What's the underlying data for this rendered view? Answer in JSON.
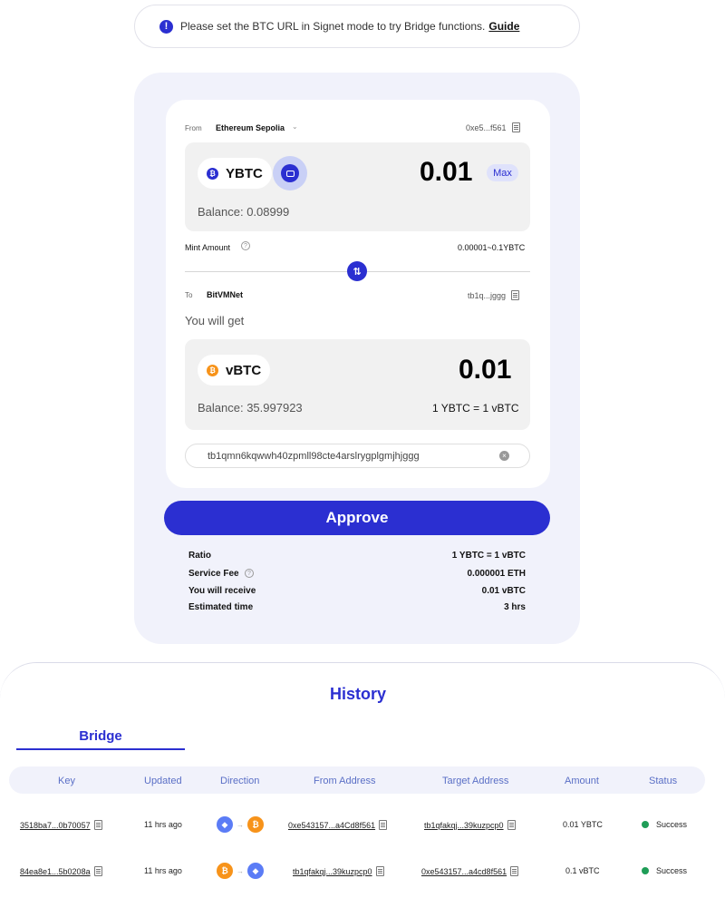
{
  "banner": {
    "message": "Please set the BTC URL in Signet mode to try Bridge functions.",
    "link": "Guide"
  },
  "bridge_form": {
    "from_label": "From",
    "from_network": "Ethereum Sepolia",
    "from_address": "0xe5...f561",
    "from_token": "YBTC",
    "amount": "0.01",
    "max_label": "Max",
    "from_balance": "Balance: 0.08999",
    "mint_amount_label": "Mint Amount",
    "mint_range": "0.00001~0.1YBTC",
    "to_label": "To",
    "to_network": "BitVMNet",
    "to_address": "tb1q...jggg",
    "you_will_get": "You will get",
    "to_token": "vBTC",
    "receive_amount": "0.01",
    "to_balance": "Balance: 35.997923",
    "rate": "1 YBTC = 1 vBTC",
    "recipient_address": "tb1qmn6kqwwh40zpmll98cte4arslrygplgmjhjggg"
  },
  "approve_label": "Approve",
  "summary": {
    "rows": [
      {
        "label": "Ratio",
        "value": "1 YBTC = 1 vBTC"
      },
      {
        "label": "Service Fee",
        "value": "0.000001 ETH"
      },
      {
        "label": "You will receive",
        "value": "0.01 vBTC"
      },
      {
        "label": "Estimated time",
        "value": "3 hrs"
      }
    ]
  },
  "history": {
    "title": "History",
    "tab": "Bridge",
    "columns": [
      "Key",
      "Updated",
      "Direction",
      "From Address",
      "Target Address",
      "Amount",
      "Status"
    ],
    "rows": [
      {
        "key": "3518ba7...0b70057",
        "updated": "11 hrs ago",
        "direction": [
          "eth",
          "btc"
        ],
        "from": "0xe543157...a4Cd8f561",
        "target": "tb1qfakqj...39kuzpcp0",
        "amount": "0.01 YBTC",
        "status": "Success"
      },
      {
        "key": "84ea8e1...5b0208a",
        "updated": "11 hrs ago",
        "direction": [
          "btc",
          "eth"
        ],
        "from": "tb1qfakqj...39kuzpcp0",
        "target": "0xe543157...a4cd8f561",
        "amount": "0.1 vBTC",
        "status": "Success"
      }
    ]
  },
  "colors": {
    "accent": "#2b2fd1",
    "success": "#1f9d57",
    "btc": "#f7931a"
  }
}
